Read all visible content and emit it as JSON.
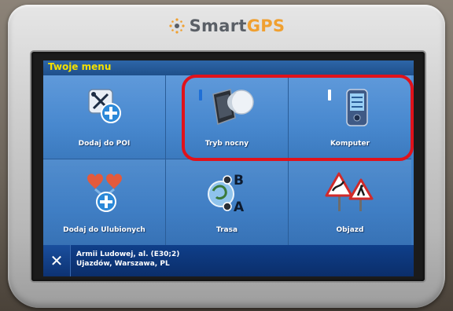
{
  "brand": {
    "part1": "Smart",
    "part2": "GPS"
  },
  "menu": {
    "title": "Twoje menu"
  },
  "tiles": [
    {
      "label": "Dodaj do POI",
      "icon": "add-poi-icon"
    },
    {
      "label": "Tryb nocny",
      "icon": "night-mode-icon"
    },
    {
      "label": "Komputer",
      "icon": "computer-icon"
    },
    {
      "label": "Dodaj do Ulubionych",
      "icon": "add-favourites-icon"
    },
    {
      "label": "Trasa",
      "icon": "route-icon"
    },
    {
      "label": "Objazd",
      "icon": "detour-icon"
    }
  ],
  "status": {
    "close_glyph": "✕",
    "line1": "Armii Ludowej, al. (E30;2)",
    "line2": "Ujazdów, Warszawa, PL"
  },
  "colors": {
    "title_text": "#f3e000",
    "screen_bg": "#3a78bf",
    "status_bg": "#0b2e6a",
    "highlight": "#e0121b",
    "brand_gps": "#f0a030"
  }
}
